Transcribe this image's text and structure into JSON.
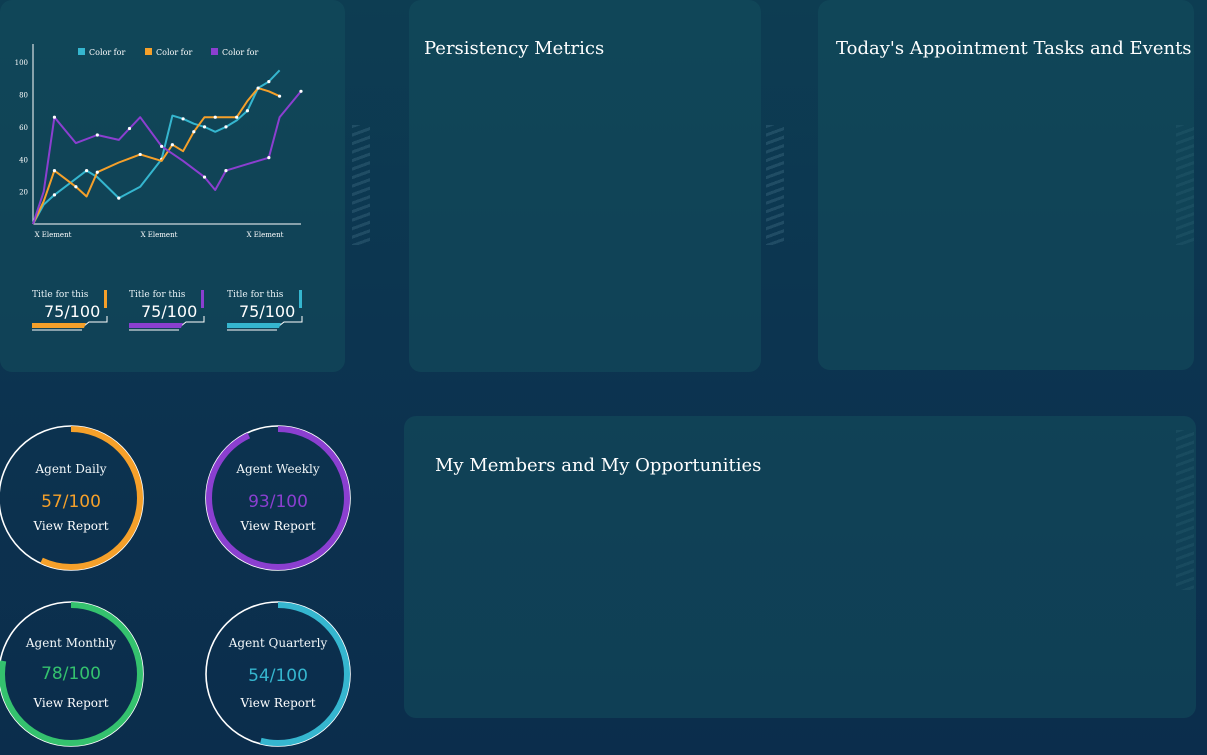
{
  "colors": {
    "orange": "#f5a02a",
    "purple": "#8b3fd0",
    "cyan": "#35b6cf",
    "green": "#34c26e"
  },
  "chart_data": {
    "type": "line",
    "legend": [
      "Color for",
      "Color for",
      "Color for"
    ],
    "x_tick_labels": [
      "X Element",
      "X Element",
      "X Element"
    ],
    "yticks": [
      20,
      40,
      60,
      80,
      100
    ],
    "ylim": [
      0,
      110
    ],
    "x": [
      0,
      1,
      2,
      3,
      4,
      5,
      6,
      7,
      8,
      9,
      10,
      11,
      12,
      13,
      14,
      15,
      16,
      17,
      18,
      19,
      20,
      21,
      22,
      23
    ],
    "series": [
      {
        "name": "Color for",
        "color": "#35b6cf",
        "points": [
          [
            0,
            0
          ],
          [
            1,
            12
          ],
          [
            2,
            18
          ],
          [
            4,
            28
          ],
          [
            5,
            33
          ],
          [
            6,
            29
          ],
          [
            8,
            16
          ],
          [
            10,
            23
          ],
          [
            12,
            40
          ],
          [
            13,
            67
          ],
          [
            14,
            65
          ],
          [
            15,
            62
          ],
          [
            16,
            60
          ],
          [
            17,
            57
          ],
          [
            18,
            60
          ],
          [
            19,
            64
          ],
          [
            20,
            70
          ],
          [
            21,
            84
          ],
          [
            22,
            88
          ],
          [
            23,
            95
          ]
        ]
      },
      {
        "name": "Color for",
        "color": "#f5a02a",
        "points": [
          [
            0,
            0
          ],
          [
            1,
            14
          ],
          [
            2,
            33
          ],
          [
            3,
            28
          ],
          [
            4,
            23
          ],
          [
            5,
            17
          ],
          [
            6,
            32
          ],
          [
            8,
            38
          ],
          [
            10,
            43
          ],
          [
            12,
            39
          ],
          [
            13,
            49
          ],
          [
            14,
            45
          ],
          [
            15,
            57
          ],
          [
            16,
            66
          ],
          [
            17,
            66
          ],
          [
            18,
            66
          ],
          [
            19,
            66
          ],
          [
            20,
            76
          ],
          [
            21,
            84
          ],
          [
            22,
            82
          ],
          [
            23,
            79
          ]
        ]
      },
      {
        "name": "Color for",
        "color": "#8b3fd0",
        "points": [
          [
            0,
            0
          ],
          [
            1,
            20
          ],
          [
            2,
            66
          ],
          [
            4,
            50
          ],
          [
            6,
            55
          ],
          [
            8,
            52
          ],
          [
            9,
            59
          ],
          [
            10,
            66
          ],
          [
            12,
            48
          ],
          [
            14,
            39
          ],
          [
            16,
            29
          ],
          [
            17,
            21
          ],
          [
            18,
            33
          ],
          [
            20,
            37
          ],
          [
            22,
            41
          ],
          [
            23,
            66
          ],
          [
            25,
            82
          ]
        ]
      }
    ]
  },
  "stats": [
    {
      "title": "Title for this",
      "value": "75/100",
      "color": "#f5a02a"
    },
    {
      "title": "Title for this",
      "value": "75/100",
      "color": "#8b3fd0"
    },
    {
      "title": "Title for this",
      "value": "75/100",
      "color": "#35b6cf"
    }
  ],
  "panels": {
    "persistency_title": "Persistency Metrics",
    "appointments_title": "Today's Appointment Tasks and Events",
    "members_title": "My Members and My Opportunities"
  },
  "gauges": [
    {
      "name": "Agent Daily",
      "value": "57/100",
      "progress": 0.57,
      "color": "#f5a02a",
      "link": "View Report"
    },
    {
      "name": "Agent Weekly",
      "value": "93/100",
      "progress": 0.93,
      "color": "#8b3fd0",
      "link": "View Report"
    },
    {
      "name": "Agent Monthly",
      "value": "78/100",
      "progress": 0.78,
      "color": "#34c26e",
      "link": "View Report"
    },
    {
      "name": "Agent Quarterly",
      "value": "54/100",
      "progress": 0.54,
      "color": "#35b6cf",
      "link": "View Report"
    }
  ]
}
